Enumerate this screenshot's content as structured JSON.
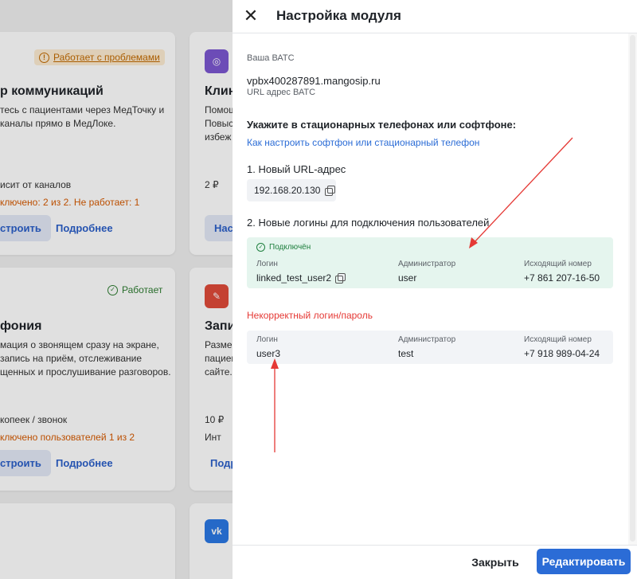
{
  "background": {
    "card1": {
      "status": "Работает с проблемами",
      "title": "р коммуникаций",
      "desc_line1": "тесь с пациентами через МедТочку и",
      "desc_line2": "каналы прямо в МедЛоке.",
      "price": "исит от каналов",
      "state": "ключено: 2 из 2. Не работает: 1",
      "btn_setup": "строить",
      "btn_more": "Подробнее"
    },
    "card2": {
      "title": "Клин",
      "desc_line1": "Помощ",
      "desc_line2": "Повыс",
      "desc_line3": "избеж",
      "price": "2 ₽",
      "btn": "Нас"
    },
    "card3": {
      "status": "Работает",
      "title": "фония",
      "desc_line1": "мация о звонящем сразу на экране,",
      "desc_line2": "запись на приём, отслеживание",
      "desc_line3": "щенных и прослушивание разговоров.",
      "price": "копеек / звонок",
      "state": "ключено пользователей 1 из 2",
      "btn_setup": "строить",
      "btn_more": "Подробнее"
    },
    "card4": {
      "title": "Запи",
      "desc_line1": "Размец",
      "desc_line2": "пациен",
      "desc_line3": "сайте.",
      "price": "10 ₽",
      "extra": "Инт",
      "link": "Подр"
    }
  },
  "panel": {
    "title": "Настройка модуля",
    "vats_label": "Ваша ВАТС",
    "vats_value": "vpbx400287891.mangosip.ru",
    "vats_hint": "URL адрес ВАТС",
    "instruction": "Укажите в стационарных телефонах или софтфоне:",
    "help_link": "Как настроить софтфон или стационарный телефон",
    "step1": "1. Новый URL-адрес",
    "ip": "192.168.20.130",
    "step2": "2. Новые логины для подключения пользователей",
    "connected": {
      "status": "Подключён",
      "headers": [
        "Логин",
        "Администратор",
        "Исходящий номер"
      ],
      "values": [
        "linked_test_user2",
        "user",
        "+7 861 207-16-50"
      ]
    },
    "error": {
      "title": "Некорректный логин/пароль",
      "headers": [
        "Логин",
        "Администратор",
        "Исходящий номер"
      ],
      "values": [
        "user3",
        "test",
        "+7 918 989-04-24"
      ]
    },
    "footer": {
      "close_label": "Закрыть",
      "edit_label": "Редактировать"
    }
  },
  "colors": {
    "accent": "#2b6cd6",
    "success_bg": "#e5f5ee",
    "error": "#e53935",
    "annotation_arrow": "#e53935"
  }
}
